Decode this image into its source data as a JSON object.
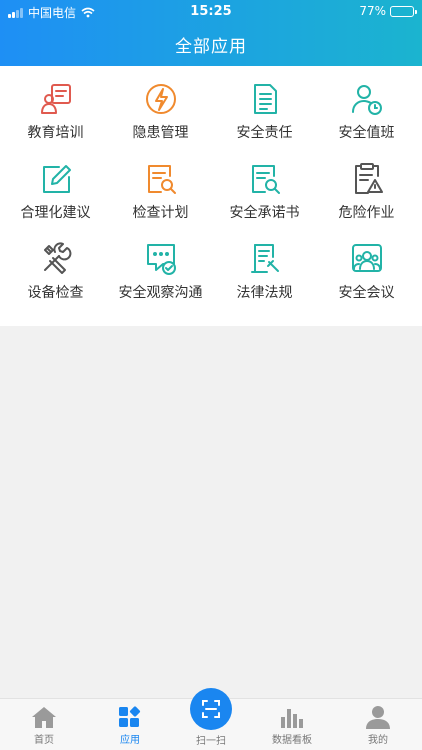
{
  "status_bar": {
    "carrier": "中国电信",
    "time": "15:25",
    "battery": "77%",
    "battery_level": 0.77
  },
  "header": {
    "title": "全部应用"
  },
  "apps": [
    {
      "label": "教育培训",
      "icon": "training-icon",
      "color": "#e05a4f"
    },
    {
      "label": "隐患管理",
      "icon": "lightning-icon",
      "color": "#f08a2e"
    },
    {
      "label": "安全责任",
      "icon": "document-icon",
      "color": "#22b3a7"
    },
    {
      "label": "安全值班",
      "icon": "user-clock-icon",
      "color": "#22b3a7"
    },
    {
      "label": "合理化建议",
      "icon": "edit-icon",
      "color": "#22b3a7"
    },
    {
      "label": "检查计划",
      "icon": "search-document-icon",
      "color": "#f08a2e"
    },
    {
      "label": "安全承诺书",
      "icon": "search-document-icon",
      "color": "#22b3a7"
    },
    {
      "label": "危险作业",
      "icon": "warning-clipboard-icon",
      "color": "#555555"
    },
    {
      "label": "设备检查",
      "icon": "tools-icon",
      "color": "#555555"
    },
    {
      "label": "安全观察沟通",
      "icon": "chat-check-icon",
      "color": "#22b3a7"
    },
    {
      "label": "法律法规",
      "icon": "law-book-icon",
      "color": "#22b3a7"
    },
    {
      "label": "安全会议",
      "icon": "meeting-icon",
      "color": "#22b3a7"
    }
  ],
  "tabbar": {
    "home": "首页",
    "apps": "应用",
    "scan": "扫一扫",
    "dashboard": "数据看板",
    "mine": "我的"
  },
  "colors": {
    "accent": "#1a86f0",
    "teal": "#22b3a7",
    "orange": "#f08a2e",
    "red": "#e05a4f"
  }
}
